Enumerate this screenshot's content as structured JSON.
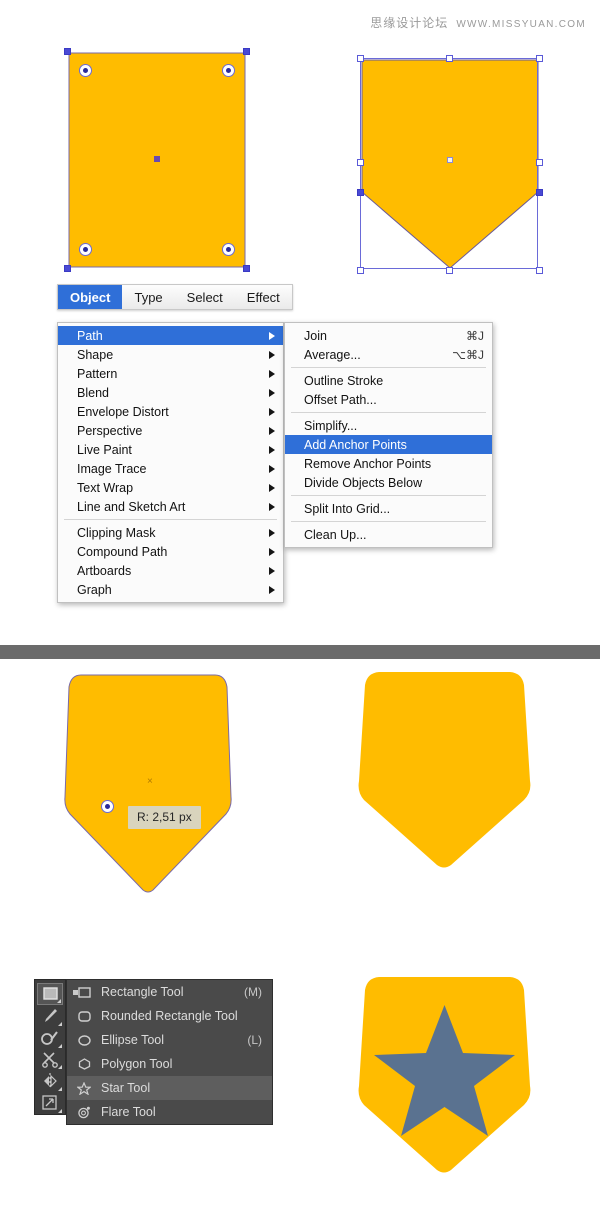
{
  "watermark": {
    "chinese": "思缘设计论坛",
    "url": "WWW.MISSYUAN.COM"
  },
  "colors": {
    "shape_fill": "#FFBC00",
    "star_fill": "#5A7290",
    "selection_blue": "#4A4AD4",
    "menu_highlight": "#2F6FD8",
    "panel_bg": "#3D3D3D",
    "divider_gray": "#6B6B6B",
    "tooltip_bg": "#D9D4BD"
  },
  "menubar": {
    "items": [
      {
        "label": "Object",
        "active": true
      },
      {
        "label": "Type",
        "active": false
      },
      {
        "label": "Select",
        "active": false
      },
      {
        "label": "Effect",
        "active": false
      }
    ]
  },
  "object_menu": {
    "groups": [
      [
        {
          "label": "Path",
          "submenu": true,
          "selected": true
        },
        {
          "label": "Shape",
          "submenu": true,
          "selected": false
        },
        {
          "label": "Pattern",
          "submenu": true,
          "selected": false
        },
        {
          "label": "Blend",
          "submenu": true,
          "selected": false
        },
        {
          "label": "Envelope Distort",
          "submenu": true,
          "selected": false
        },
        {
          "label": "Perspective",
          "submenu": true,
          "selected": false
        },
        {
          "label": "Live Paint",
          "submenu": true,
          "selected": false
        },
        {
          "label": "Image Trace",
          "submenu": true,
          "selected": false
        },
        {
          "label": "Text Wrap",
          "submenu": true,
          "selected": false
        },
        {
          "label": "Line and Sketch Art",
          "submenu": true,
          "selected": false
        }
      ],
      [
        {
          "label": "Clipping Mask",
          "submenu": true,
          "selected": false
        },
        {
          "label": "Compound Path",
          "submenu": true,
          "selected": false
        },
        {
          "label": "Artboards",
          "submenu": true,
          "selected": false
        },
        {
          "label": "Graph",
          "submenu": true,
          "selected": false
        }
      ]
    ]
  },
  "path_submenu": {
    "groups": [
      [
        {
          "label": "Join",
          "shortcut": "⌘J",
          "selected": false
        },
        {
          "label": "Average...",
          "shortcut": "⌥⌘J",
          "selected": false
        }
      ],
      [
        {
          "label": "Outline Stroke",
          "shortcut": "",
          "selected": false
        },
        {
          "label": "Offset Path...",
          "shortcut": "",
          "selected": false
        }
      ],
      [
        {
          "label": "Simplify...",
          "shortcut": "",
          "selected": false
        },
        {
          "label": "Add Anchor Points",
          "shortcut": "",
          "selected": true
        },
        {
          "label": "Remove Anchor Points",
          "shortcut": "",
          "selected": false
        },
        {
          "label": "Divide Objects Below",
          "shortcut": "",
          "selected": false
        }
      ],
      [
        {
          "label": "Split Into Grid...",
          "shortcut": "",
          "selected": false
        }
      ],
      [
        {
          "label": "Clean Up...",
          "shortcut": "",
          "selected": false
        }
      ]
    ]
  },
  "tools_flyout": {
    "items": [
      {
        "icon": "rectangle-icon",
        "label": "Rectangle Tool",
        "key": "(M)",
        "highlighted": false,
        "current": true
      },
      {
        "icon": "rounded-rectangle-icon",
        "label": "Rounded Rectangle Tool",
        "key": "",
        "highlighted": false,
        "current": false
      },
      {
        "icon": "ellipse-icon",
        "label": "Ellipse Tool",
        "key": "(L)",
        "highlighted": false,
        "current": false
      },
      {
        "icon": "polygon-icon",
        "label": "Polygon Tool",
        "key": "",
        "highlighted": false,
        "current": false
      },
      {
        "icon": "star-icon",
        "label": "Star Tool",
        "key": "",
        "highlighted": true,
        "current": false
      },
      {
        "icon": "flare-icon",
        "label": "Flare Tool",
        "key": "",
        "highlighted": false,
        "current": false
      }
    ]
  },
  "toolbar_strip": {
    "buttons": [
      {
        "icon": "rectangle-tool-icon",
        "active": true
      },
      {
        "icon": "paintbrush-tool-icon",
        "active": false
      },
      {
        "icon": "blob-brush-tool-icon",
        "active": false
      },
      {
        "icon": "scissors-tool-icon",
        "active": false
      },
      {
        "icon": "reflect-tool-icon",
        "active": false
      },
      {
        "icon": "scale-tool-icon",
        "active": false
      }
    ]
  },
  "tooltips": {
    "corner_radius": "R: 2,51 px"
  },
  "shapes": {
    "step1": {
      "name": "selected-rectangle",
      "description": "Rectangle with live corner widgets selected"
    },
    "step2": {
      "name": "pentagon-shield",
      "description": "Shield formed by pulling bottom anchor down"
    },
    "step3": {
      "name": "rounded-shield-editing",
      "description": "Shield with corner radius being dragged"
    },
    "step4": {
      "name": "rounded-shield",
      "description": "Finished rounded shield"
    },
    "step5": {
      "name": "shield-with-star",
      "description": "Shield badge with star"
    }
  }
}
